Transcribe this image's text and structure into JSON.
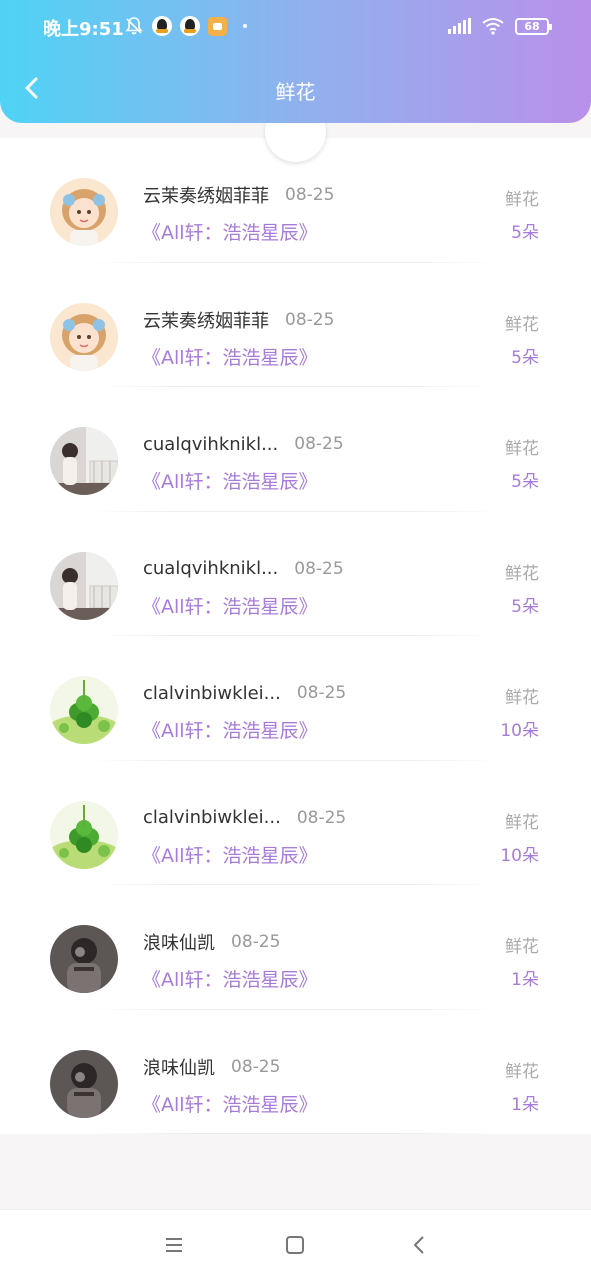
{
  "status_bar": {
    "time": "晚上9:51",
    "battery": "68"
  },
  "header": {
    "title": "鲜花"
  },
  "icons": {
    "back": "chevron-left-icon",
    "mute": "bell-off-icon",
    "qq": "qq-penguin-icon",
    "message": "message-app-icon",
    "signal": "signal-icon",
    "wifi": "wifi-icon",
    "battery": "battery-icon"
  },
  "colors": {
    "accent_purple": "#a77cd8",
    "header_start": "#4fd3f5",
    "header_end": "#b990ea"
  },
  "items": [
    {
      "avatar": "doll",
      "nickname": "云茉奏绣姻菲菲",
      "date": "08-25",
      "book": "《All轩：浩浩星辰》",
      "gift_label": "鲜花",
      "gift_count": "5朵"
    },
    {
      "avatar": "doll",
      "nickname": "云茉奏绣姻菲菲",
      "date": "08-25",
      "book": "《All轩：浩浩星辰》",
      "gift_label": "鲜花",
      "gift_count": "5朵"
    },
    {
      "avatar": "room",
      "nickname": "cualqvihknikl...",
      "date": "08-25",
      "book": "《All轩：浩浩星辰》",
      "gift_label": "鲜花",
      "gift_count": "5朵"
    },
    {
      "avatar": "room",
      "nickname": "cualqvihknikl...",
      "date": "08-25",
      "book": "《All轩：浩浩星辰》",
      "gift_label": "鲜花",
      "gift_count": "5朵"
    },
    {
      "avatar": "clover",
      "nickname": "clalvinbiwklei...",
      "date": "08-25",
      "book": "《All轩：浩浩星辰》",
      "gift_label": "鲜花",
      "gift_count": "10朵"
    },
    {
      "avatar": "clover",
      "nickname": "clalvinbiwklei...",
      "date": "08-25",
      "book": "《All轩：浩浩星辰》",
      "gift_label": "鲜花",
      "gift_count": "10朵"
    },
    {
      "avatar": "dark",
      "nickname": "浪味仙凯",
      "date": "08-25",
      "book": "《All轩：浩浩星辰》",
      "gift_label": "鲜花",
      "gift_count": "1朵"
    },
    {
      "avatar": "dark",
      "nickname": "浪味仙凯",
      "date": "08-25",
      "book": "《All轩：浩浩星辰》",
      "gift_label": "鲜花",
      "gift_count": "1朵"
    }
  ],
  "nav": {
    "menu": "menu-icon",
    "home": "square-home-icon",
    "back": "back-triangle-icon"
  }
}
